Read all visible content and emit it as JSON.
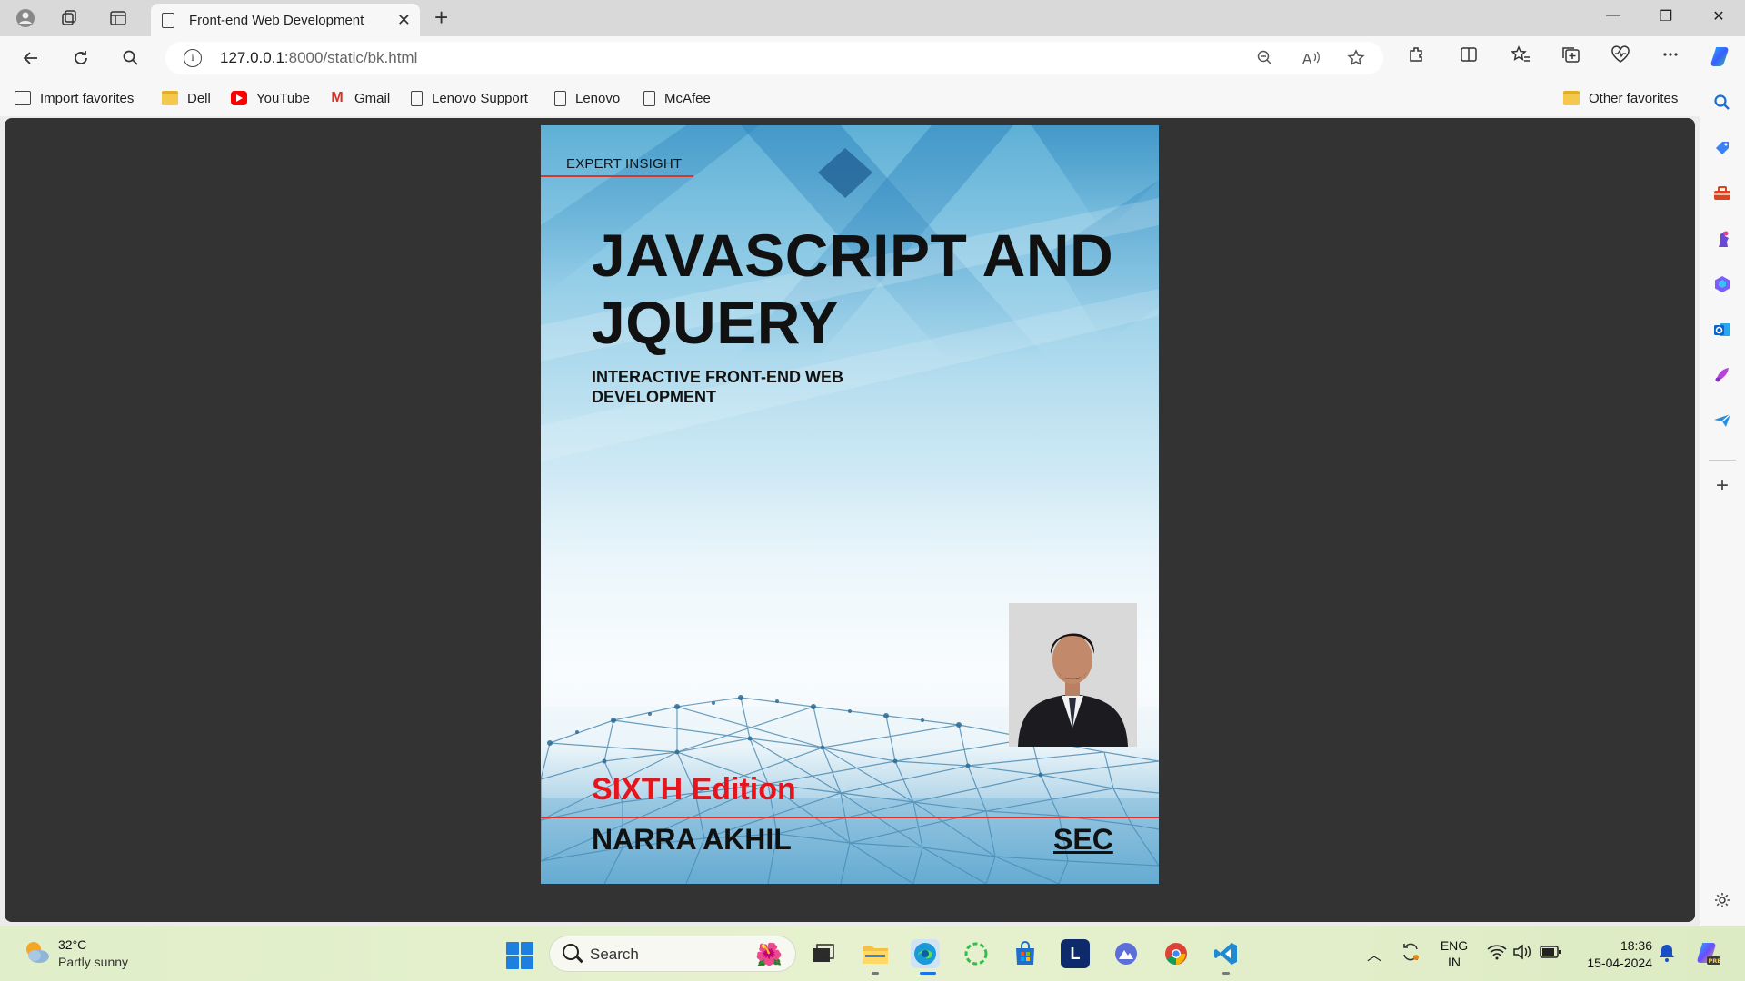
{
  "browser": {
    "tab_title": "Front-end Web Development",
    "url_host": "127.0.0.1",
    "url_rest": ":8000/static/bk.html"
  },
  "favorites": [
    {
      "label": "Import favorites",
      "icon": "import-icon"
    },
    {
      "label": "Dell",
      "icon": "folder-icon"
    },
    {
      "label": "YouTube",
      "icon": "youtube-icon"
    },
    {
      "label": "Gmail",
      "icon": "gmail-icon"
    },
    {
      "label": "Lenovo Support",
      "icon": "page-icon"
    },
    {
      "label": "Lenovo",
      "icon": "page-icon"
    },
    {
      "label": "McAfee",
      "icon": "page-icon"
    }
  ],
  "other_favorites": "Other favorites",
  "cover": {
    "series_label": "EXPERT INSIGHT",
    "title": "JAVASCRIPT AND JQUERY",
    "subtitle": "INTERACTIVE FRONT-END WEB DEVELOPMENT",
    "edition": "SIXTH Edition",
    "author": "NARRA AKHIL",
    "publisher": "SEC",
    "edition_color": "#e8141c",
    "accent_rule_color": "#d9352a"
  },
  "taskbar": {
    "weather_temp": "32°C",
    "weather_desc": "Partly sunny",
    "search_placeholder": "Search",
    "lang_line1": "ENG",
    "lang_line2": "IN",
    "time": "18:36",
    "date": "15-04-2024"
  },
  "sidebar": {
    "icons": [
      "search-icon",
      "tag-icon",
      "toolbox-icon",
      "games-icon",
      "microsoft365-icon",
      "outlook-icon",
      "designer-icon",
      "send-icon",
      "add-icon",
      "settings-icon"
    ]
  }
}
